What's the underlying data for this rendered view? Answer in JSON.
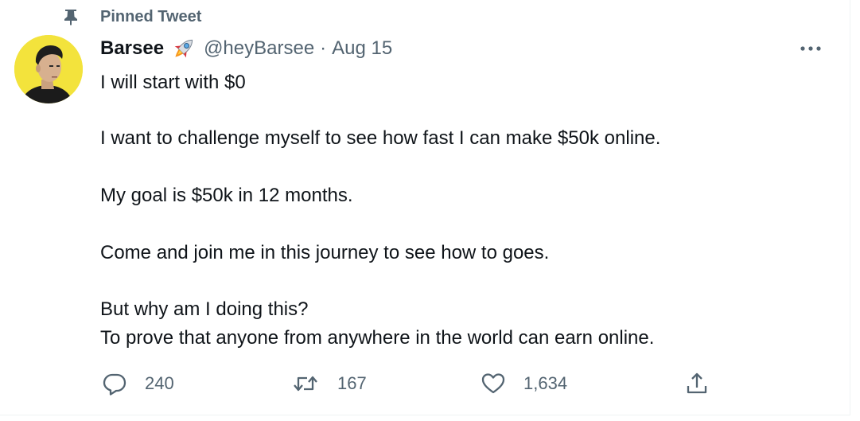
{
  "pinned": {
    "label": "Pinned Tweet",
    "icon": "pin-icon"
  },
  "author": {
    "name": "Barsee",
    "emoji_icon": "rocket-icon",
    "handle": "@heyBarsee",
    "separator": "·",
    "date": "Aug 15",
    "avatar_bg": "#f3e33c"
  },
  "more_icon": "more-horizontal-icon",
  "tweet": {
    "lines": [
      "I will start with $0",
      "I want to challenge myself to see how fast I can make $50k online.",
      "My goal is $50k in 12 months.",
      "Come and join me in this journey to see how to goes.",
      "But why am I doing this?",
      "To prove that anyone from anywhere in the world can earn online."
    ]
  },
  "actions": {
    "reply": {
      "icon": "reply-icon",
      "count": "240"
    },
    "retweet": {
      "icon": "retweet-icon",
      "count": "167"
    },
    "like": {
      "icon": "heart-icon",
      "count": "1,634"
    },
    "share": {
      "icon": "share-icon"
    }
  },
  "colors": {
    "text": "#0f1419",
    "secondary": "#536471",
    "border": "#eff3f4"
  }
}
